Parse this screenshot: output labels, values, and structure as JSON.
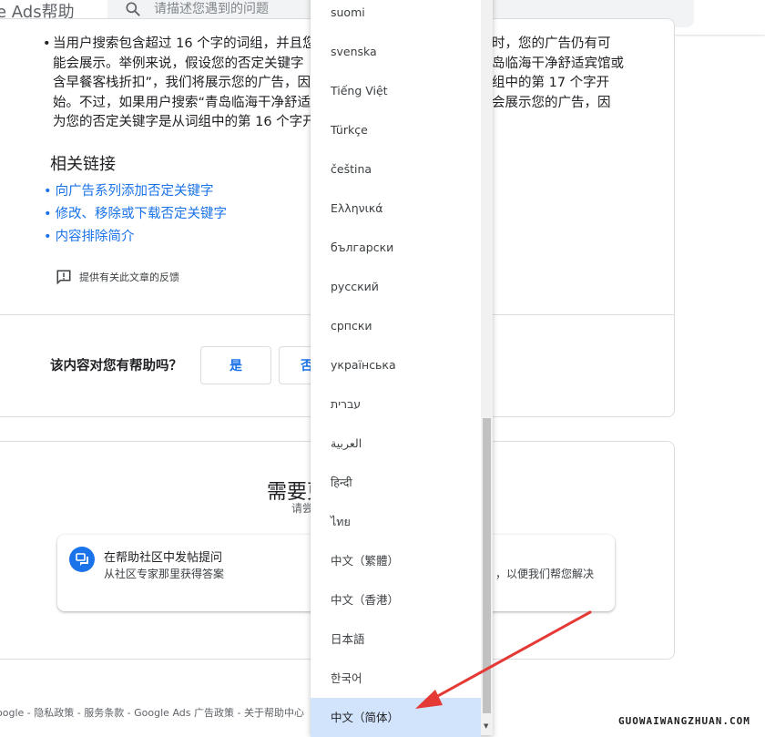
{
  "header": {
    "app_title": "e Ads帮助",
    "search_placeholder": "请描述您遇到的问题",
    "search_icon": "search-icon"
  },
  "article": {
    "bullet_lines": [
      "当用户搜索包含超过 16 个字的词组，并且您",
      "能会展示。举例来说，假设您的否定关键字",
      "含早餐客栈折扣”，我们将展示您的广告，因",
      "始。不过，如果用户搜索“青岛临海干净舒适",
      "为您的否定关键字是从词组中的第 16 个字开"
    ],
    "bullet_right_lines": [
      "时，您的广告仍有可",
      "岛临海干净舒适宾馆或",
      "组中的第 17 个字开",
      "会展示您的广告，因"
    ],
    "related_title": "相关链接",
    "links": [
      "向广告系列添加否定关键字",
      "修改、移除或下载否定关键字",
      "内容排除简介"
    ],
    "feedback_label": "提供有关此文章的反馈",
    "feedback_icon": "feedback-icon",
    "helpful_question": "该内容对您有帮助吗？",
    "yes_label": "是",
    "no_label": "否"
  },
  "help": {
    "title": "需要更",
    "subtitle": "请尝",
    "community_icon": "forum-icon",
    "option_title": "在帮助社区中发帖提问",
    "option_desc": "从社区专家那里获得答案",
    "option_desc_right": "，以便我们帮您解决"
  },
  "footer": {
    "text": "oogle - 隐私政策 - 服务条款 - Google Ads 广告政策 - 关于帮助中心"
  },
  "watermark": "GUOWAIWANGZHUAN.COM",
  "language_menu": {
    "items": [
      "suomi",
      "svenska",
      "Tiếng Việt",
      "Türkçe",
      "čeština",
      "Ελληνικά",
      "български",
      "русский",
      "српски",
      "українська",
      "עברית",
      "العربية",
      "हिन्दी",
      "ไทย",
      "中文（繁體）",
      "中文（香港）",
      "日本語",
      "한국어",
      "中文（简体）"
    ],
    "selected": "中文（简体）"
  },
  "colors": {
    "link": "#1a73e8",
    "selected_bg": "#d2e3fc",
    "annotation_arrow": "#e53935"
  }
}
